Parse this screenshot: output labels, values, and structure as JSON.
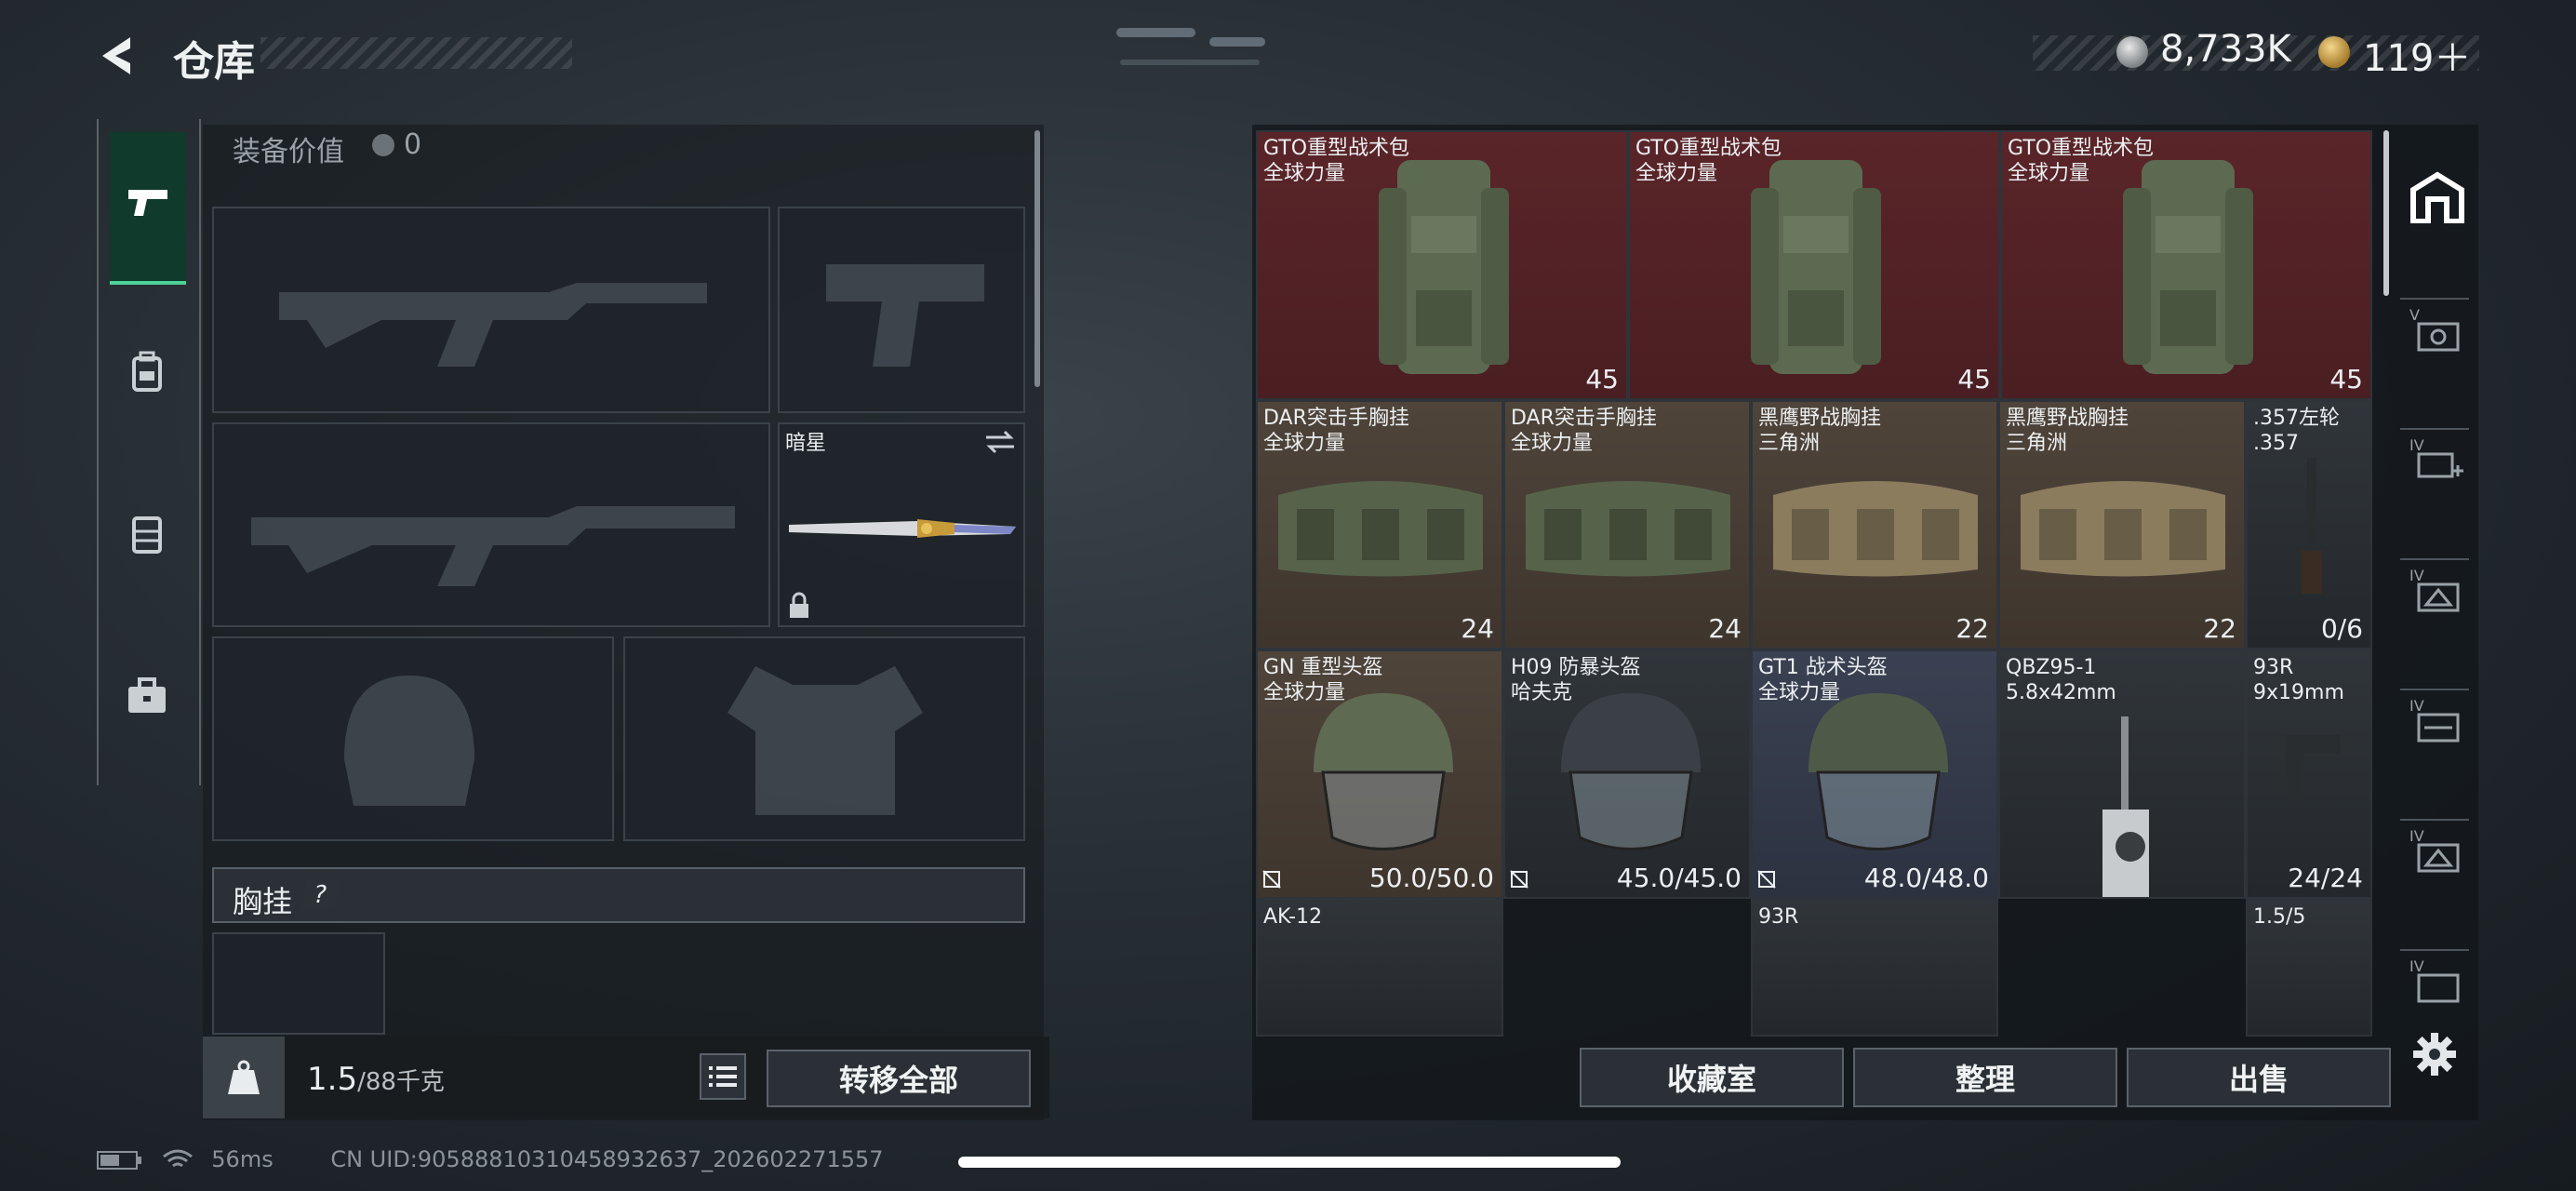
{
  "header": {
    "title": "仓库",
    "currency_silver": "8,733K",
    "currency_gold": "119＋"
  },
  "left_panel": {
    "equipment_value_label": "装备价值",
    "equipment_value": "0",
    "melee_name": "暗星",
    "chest_rig_label": "胸挂",
    "chest_rig_help": "?",
    "weight_current": "1.5",
    "weight_max": "/88千克",
    "transfer_all_label": "转移全部"
  },
  "inventory": {
    "items": [
      {
        "name": "GTO重型战术包",
        "source": "全球力量",
        "count": "45",
        "style": "red"
      },
      {
        "name": "GTO重型战术包",
        "source": "全球力量",
        "count": "45",
        "style": "red"
      },
      {
        "name": "GTO重型战术包",
        "source": "全球力量",
        "count": "45",
        "style": "red"
      },
      {
        "name": "DAR突击手胸挂",
        "source": "全球力量",
        "count": "24",
        "style": "brown"
      },
      {
        "name": "DAR突击手胸挂",
        "source": "全球力量",
        "count": "24",
        "style": "brown"
      },
      {
        "name": "黑鹰野战胸挂",
        "source": "三角洲",
        "count": "22",
        "style": "brown"
      },
      {
        "name": "黑鹰野战胸挂",
        "source": "三角洲",
        "count": "22",
        "style": "brown"
      },
      {
        "name": ".357左轮",
        "source": ".357",
        "count": "0/6",
        "style": "dark"
      },
      {
        "name": "GN 重型头盔",
        "source": "全球力量",
        "count": "50.0/50.0",
        "style": "brown"
      },
      {
        "name": "H09 防暴头盔",
        "source": "哈夫克",
        "count": "45.0/45.0",
        "style": "dark"
      },
      {
        "name": "GT1 战术头盔",
        "source": "全球力量",
        "count": "48.0/48.0",
        "style": "blue"
      },
      {
        "name": "QBZ95-1",
        "source": "5.8x42mm",
        "count": "",
        "style": "dark"
      },
      {
        "name": "93R",
        "source": "9x19mm",
        "count": "24/24",
        "style": "dark"
      },
      {
        "name": "AK-12",
        "source": "",
        "count": "",
        "style": "dark"
      },
      {
        "name": "93R",
        "source": "",
        "count": "",
        "style": "dark"
      },
      {
        "name": "1.5/5",
        "source": "",
        "count": "",
        "style": "dark"
      }
    ],
    "storage_label": "收藏室",
    "sort_label": "整理",
    "sell_label": "出售"
  },
  "right_rail": {
    "tabs": [
      "warehouse-home-icon",
      "v-tab-icon",
      "iv-tab-icon-1",
      "iv-tab-icon-2",
      "iv-tab-icon-3",
      "iv-tab-icon-4",
      "iv-tab-icon-5"
    ]
  },
  "status_bar": {
    "ping": "56ms",
    "uid": "CN UID:90588810310458932637_202602271557"
  }
}
